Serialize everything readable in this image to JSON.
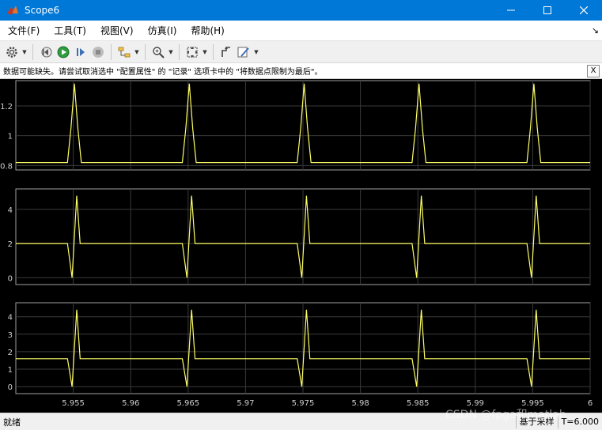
{
  "window": {
    "title": "Scope6"
  },
  "menu": [
    "文件(F)",
    "工具(T)",
    "视图(V)",
    "仿真(I)",
    "帮助(H)"
  ],
  "menu_end_glyph": "↘",
  "toolbar": {
    "icons": [
      "gear-icon",
      "step-back-icon",
      "run-icon",
      "step-forward-icon",
      "stop-icon",
      "highlight-icon",
      "zoom-icon",
      "fit-view-icon",
      "signal-select-icon",
      "style-icon"
    ]
  },
  "warning": {
    "text": "数据可能缺失。请尝试取消选中 \"配置属性\" 的 \"记录\" 选项卡中的 \"将数据点限制为最后\"。",
    "close_label": "X"
  },
  "status": {
    "left": "就绪",
    "mode": "基于采样",
    "time": "T=6.000"
  },
  "watermark": "CSDN @fpga和matlab",
  "colors": {
    "background": "#000000",
    "grid": "#3a3a3a",
    "trace": "#ffff66",
    "axis": "#a0a0a0"
  },
  "chart_data": [
    {
      "type": "line",
      "x": [
        5.95,
        5.9545,
        5.9548,
        5.9551,
        5.9554,
        5.9557,
        5.9645,
        5.9648,
        5.9651,
        5.9654,
        5.9657,
        5.9745,
        5.9748,
        5.9751,
        5.9754,
        5.9757,
        5.9845,
        5.9848,
        5.9851,
        5.9854,
        5.9857,
        5.9945,
        5.9948,
        5.9951,
        5.9954,
        5.9957,
        6.0
      ],
      "values": [
        0.82,
        0.82,
        1.05,
        1.35,
        1.05,
        0.82,
        0.82,
        1.05,
        1.35,
        1.05,
        0.82,
        0.82,
        1.05,
        1.35,
        1.05,
        0.82,
        0.82,
        1.05,
        1.35,
        1.05,
        0.82,
        0.82,
        1.05,
        1.35,
        1.05,
        0.82,
        0.82
      ],
      "yticks": [
        0.8,
        1,
        1.2
      ],
      "ylim": [
        0.77,
        1.37
      ],
      "xlim": [
        5.95,
        6.0
      ],
      "xticks": [
        5.955,
        5.96,
        5.965,
        5.97,
        5.975,
        5.98,
        5.985,
        5.99,
        5.995,
        6
      ],
      "grid": true
    },
    {
      "type": "line",
      "x": [
        5.95,
        5.9545,
        5.9549,
        5.9553,
        5.9556,
        5.9645,
        5.9649,
        5.9653,
        5.9656,
        5.9745,
        5.9749,
        5.9753,
        5.9756,
        5.9845,
        5.9849,
        5.9853,
        5.9856,
        5.9945,
        5.9949,
        5.9953,
        5.9956,
        6.0
      ],
      "values": [
        2,
        2,
        0,
        4.8,
        2,
        2,
        0,
        4.8,
        2,
        2,
        0,
        4.8,
        2,
        2,
        0,
        4.8,
        2,
        2,
        0,
        4.8,
        2,
        2
      ],
      "yticks": [
        0,
        2,
        4
      ],
      "ylim": [
        -0.4,
        5.2
      ],
      "xlim": [
        5.95,
        6.0
      ],
      "xticks": [
        5.955,
        5.96,
        5.965,
        5.97,
        5.975,
        5.98,
        5.985,
        5.99,
        5.995,
        6
      ],
      "grid": true
    },
    {
      "type": "line",
      "x": [
        5.95,
        5.9545,
        5.9549,
        5.9553,
        5.9556,
        5.9645,
        5.9649,
        5.9653,
        5.9656,
        5.9745,
        5.9749,
        5.9753,
        5.9756,
        5.9845,
        5.9849,
        5.9853,
        5.9856,
        5.9945,
        5.9949,
        5.9953,
        5.9956,
        6.0
      ],
      "values": [
        1.6,
        1.6,
        0,
        4.4,
        1.6,
        1.6,
        0,
        4.4,
        1.6,
        1.6,
        0,
        4.4,
        1.6,
        1.6,
        0,
        4.4,
        1.6,
        1.6,
        0,
        4.4,
        1.6,
        1.6
      ],
      "yticks": [
        0,
        1,
        2,
        3,
        4
      ],
      "ylim": [
        -0.4,
        4.8
      ],
      "xlim": [
        5.95,
        6.0
      ],
      "xticks": [
        5.955,
        5.96,
        5.965,
        5.97,
        5.975,
        5.98,
        5.985,
        5.99,
        5.995,
        6
      ],
      "xticklabels": [
        "5.955",
        "5.96",
        "5.965",
        "5.97",
        "5.975",
        "5.98",
        "5.985",
        "5.99",
        "5.995",
        "6"
      ],
      "grid": true
    }
  ]
}
